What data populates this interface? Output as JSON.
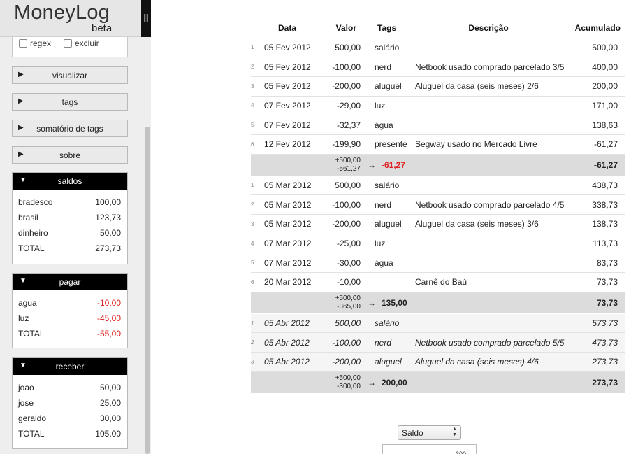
{
  "app": {
    "title": "MoneyLog",
    "subtitle": "beta",
    "toggle_label": "||"
  },
  "filters": {
    "regex_label": "regex",
    "exclude_label": "excluir"
  },
  "menu": [
    {
      "label": "visualizar"
    },
    {
      "label": "tags"
    },
    {
      "label": "somatório de tags"
    },
    {
      "label": "sobre"
    }
  ],
  "panels": {
    "saldos": {
      "title": "saldos",
      "rows": [
        {
          "name": "bradesco",
          "value": "100,00"
        },
        {
          "name": "brasil",
          "value": "123,73"
        },
        {
          "name": "dinheiro",
          "value": "50,00"
        },
        {
          "name": "TOTAL",
          "value": "273,73"
        }
      ]
    },
    "pagar": {
      "title": "pagar",
      "rows": [
        {
          "name": "agua",
          "value": "-10,00"
        },
        {
          "name": "luz",
          "value": "-45,00"
        },
        {
          "name": "TOTAL",
          "value": "-55,00"
        }
      ]
    },
    "receber": {
      "title": "receber",
      "rows": [
        {
          "name": "joao",
          "value": "50,00"
        },
        {
          "name": "jose",
          "value": "25,00"
        },
        {
          "name": "geraldo",
          "value": "30,00"
        },
        {
          "name": "TOTAL",
          "value": "105,00"
        }
      ]
    }
  },
  "table": {
    "headers": {
      "date": "Data",
      "value": "Valor",
      "tags": "Tags",
      "description": "Descrição",
      "accumulated": "Acumulado"
    },
    "rows": [
      {
        "type": "entry",
        "n": "1",
        "date": "05 Fev 2012",
        "value": "500,00",
        "tags": "salário",
        "desc": "",
        "acc": "500,00"
      },
      {
        "type": "entry",
        "n": "2",
        "date": "05 Fev 2012",
        "value": "-100,00",
        "tags": "nerd",
        "desc": "Netbook usado comprado parcelado 3/5",
        "acc": "400,00"
      },
      {
        "type": "entry",
        "n": "3",
        "date": "05 Fev 2012",
        "value": "-200,00",
        "tags": "aluguel",
        "desc": "Aluguel da casa (seis meses) 2/6",
        "acc": "200,00"
      },
      {
        "type": "entry",
        "n": "4",
        "date": "07 Fev 2012",
        "value": "-29,00",
        "tags": "luz",
        "desc": "",
        "acc": "171,00"
      },
      {
        "type": "entry",
        "n": "5",
        "date": "07 Fev 2012",
        "value": "-32,37",
        "tags": "água",
        "desc": "",
        "acc": "138,63"
      },
      {
        "type": "entry",
        "n": "6",
        "date": "12 Fev 2012",
        "value": "-199,90",
        "tags": "presente",
        "desc": "Segway usado no Mercado Livre",
        "acc": "-61,27"
      },
      {
        "type": "sum",
        "pos": "+500,00",
        "neg": "-561,27",
        "arrow": "→",
        "total": "-61,27",
        "acc": "-61,27"
      },
      {
        "type": "entry",
        "n": "1",
        "date": "05 Mar 2012",
        "value": "500,00",
        "tags": "salário",
        "desc": "",
        "acc": "438,73"
      },
      {
        "type": "entry",
        "n": "2",
        "date": "05 Mar 2012",
        "value": "-100,00",
        "tags": "nerd",
        "desc": "Netbook usado comprado parcelado 4/5",
        "acc": "338,73"
      },
      {
        "type": "entry",
        "n": "3",
        "date": "05 Mar 2012",
        "value": "-200,00",
        "tags": "aluguel",
        "desc": "Aluguel da casa (seis meses) 3/6",
        "acc": "138,73"
      },
      {
        "type": "entry",
        "n": "4",
        "date": "07 Mar 2012",
        "value": "-25,00",
        "tags": "luz",
        "desc": "",
        "acc": "113,73"
      },
      {
        "type": "entry",
        "n": "5",
        "date": "07 Mar 2012",
        "value": "-30,00",
        "tags": "água",
        "desc": "",
        "acc": "83,73"
      },
      {
        "type": "entry",
        "n": "6",
        "date": "20 Mar 2012",
        "value": "-10,00",
        "tags": "",
        "desc": "Carnê do Baú",
        "acc": "73,73"
      },
      {
        "type": "sum",
        "pos": "+500,00",
        "neg": "-365,00",
        "arrow": "→",
        "total": "135,00",
        "acc": "73,73"
      },
      {
        "type": "future",
        "n": "1",
        "date": "05 Abr 2012",
        "value": "500,00",
        "tags": "salário",
        "desc": "",
        "acc": "573,73"
      },
      {
        "type": "future",
        "n": "2",
        "date": "05 Abr 2012",
        "value": "-100,00",
        "tags": "nerd",
        "desc": "Netbook usado comprado parcelado 5/5",
        "acc": "473,73"
      },
      {
        "type": "future",
        "n": "3",
        "date": "05 Abr 2012",
        "value": "-200,00",
        "tags": "aluguel",
        "desc": "Aluguel da casa (seis meses) 4/6",
        "acc": "273,73"
      },
      {
        "type": "sum",
        "pos": "+500,00",
        "neg": "-300,00",
        "arrow": "→",
        "total": "200,00",
        "acc": "273,73"
      }
    ]
  },
  "chart_controls": {
    "selected": "Saldo",
    "tick_label": "300"
  },
  "colors": {
    "negative": "#e02020",
    "panel_header": "#000000",
    "sum_row": "#dcdcdc"
  }
}
